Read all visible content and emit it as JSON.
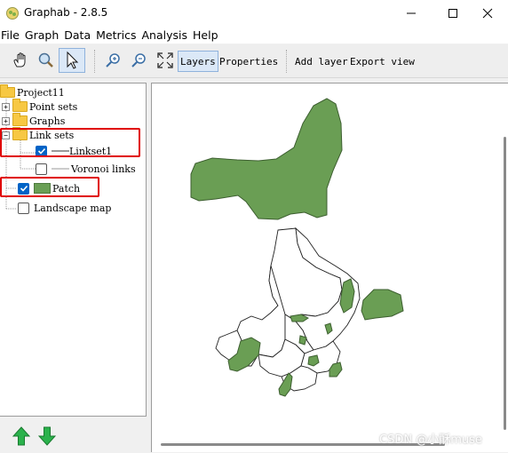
{
  "window": {
    "title": "Graphab - 2.8.5",
    "minimize_icon": "minimize-icon",
    "maximize_icon": "maximize-icon",
    "close_icon": "close-icon"
  },
  "menu": [
    "File",
    "Graph",
    "Data",
    "Metrics",
    "Analysis",
    "Help"
  ],
  "toolbar": {
    "pan_icon": "hand-icon",
    "zoom_icon": "magnifier-icon",
    "select_icon": "arrow-cursor-icon",
    "zoom_in_icon": "zoom-in-icon",
    "zoom_out_icon": "zoom-out-icon",
    "fit_icon": "fit-extent-icon",
    "layers_label": "Layers",
    "properties_label": "Properties",
    "add_layer_label": "Add layer",
    "export_view_label": "Export view"
  },
  "tree": {
    "project": "Project11",
    "point_sets": "Point sets",
    "graphs": "Graphs",
    "link_sets": "Link sets",
    "linkset1": "Linkset1",
    "linkset1_checked": true,
    "voronoi": "Voronoi links",
    "voronoi_checked": false,
    "patch": "Patch",
    "patch_checked": true,
    "landscape": "Landscape map",
    "landscape_checked": false
  },
  "colors": {
    "patch_green": "#6a9e54",
    "highlight_red": "#e00000",
    "arrow_green": "#2bb24c",
    "checkbox_blue": "#0063c6"
  },
  "bottom": {
    "up_icon": "arrow-up-icon",
    "down_icon": "arrow-down-icon"
  },
  "watermark": "CSDN @小酥muse"
}
